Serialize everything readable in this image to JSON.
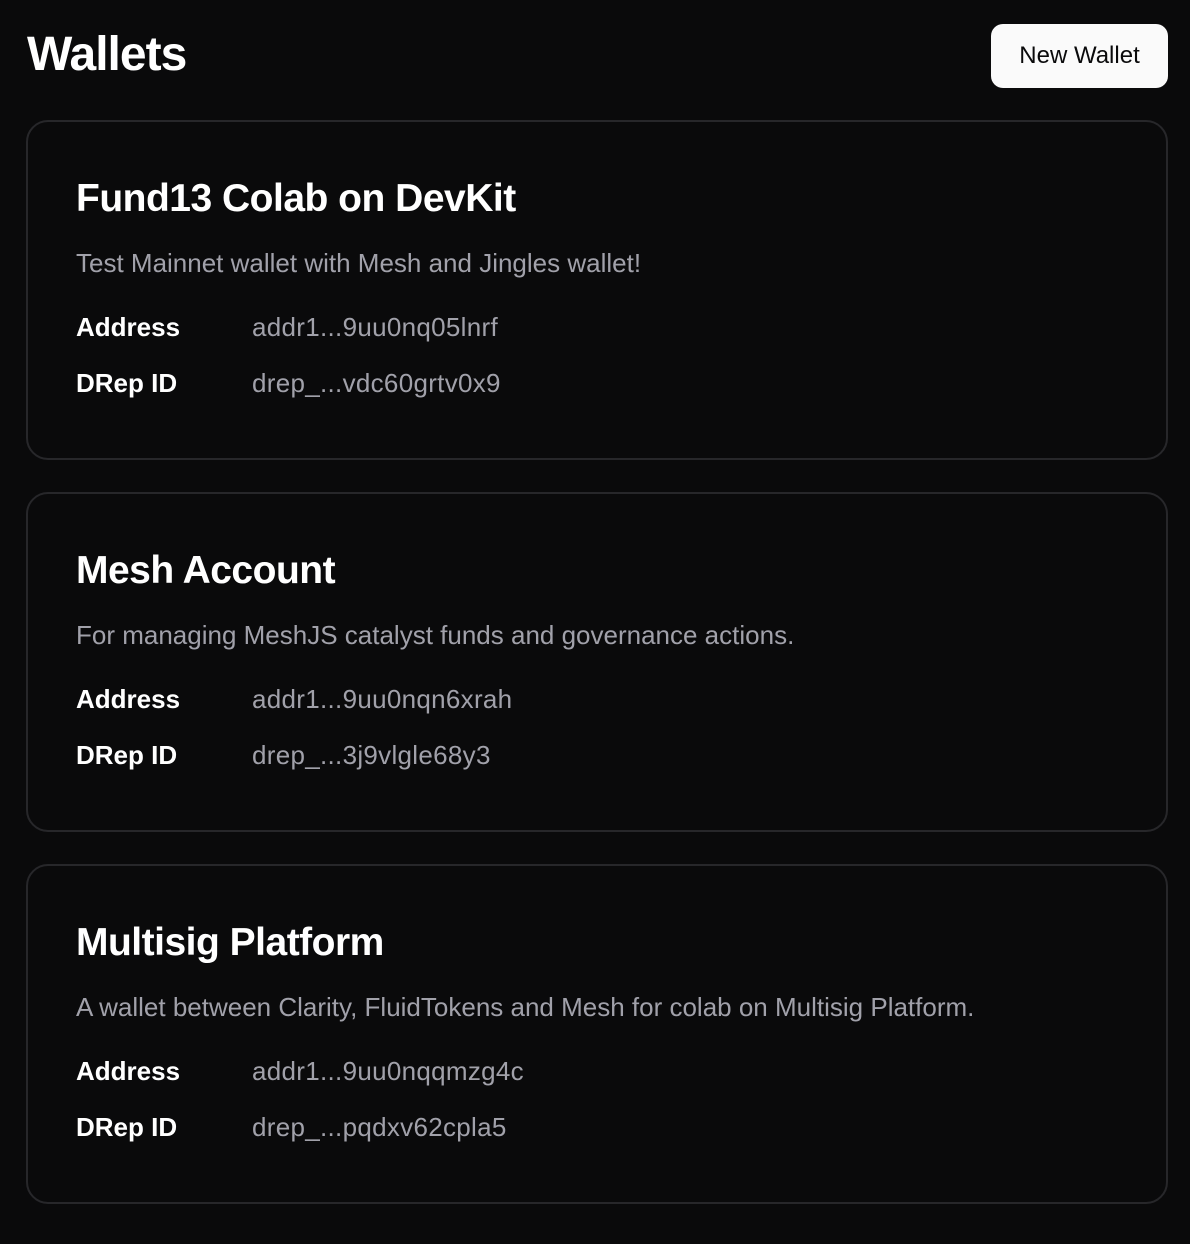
{
  "header": {
    "title": "Wallets",
    "new_wallet_label": "New Wallet"
  },
  "wallets": [
    {
      "name": "Fund13 Colab on DevKit",
      "description": "Test Mainnet wallet with Mesh and Jingles wallet!",
      "address_label": "Address",
      "address": "addr1...9uu0nq05lnrf",
      "drep_label": "DRep ID",
      "drep_id": "drep_...vdc60grtv0x9"
    },
    {
      "name": "Mesh Account",
      "description": "For managing MeshJS catalyst funds and governance actions.",
      "address_label": "Address",
      "address": "addr1...9uu0nqn6xrah",
      "drep_label": "DRep ID",
      "drep_id": "drep_...3j9vlgle68y3"
    },
    {
      "name": "Multisig Platform",
      "description": "A wallet between Clarity, FluidTokens and Mesh for colab on Multisig Platform.",
      "address_label": "Address",
      "address": "addr1...9uu0nqqmzg4c",
      "drep_label": "DRep ID",
      "drep_id": "drep_...pqdxv62cpla5"
    }
  ]
}
